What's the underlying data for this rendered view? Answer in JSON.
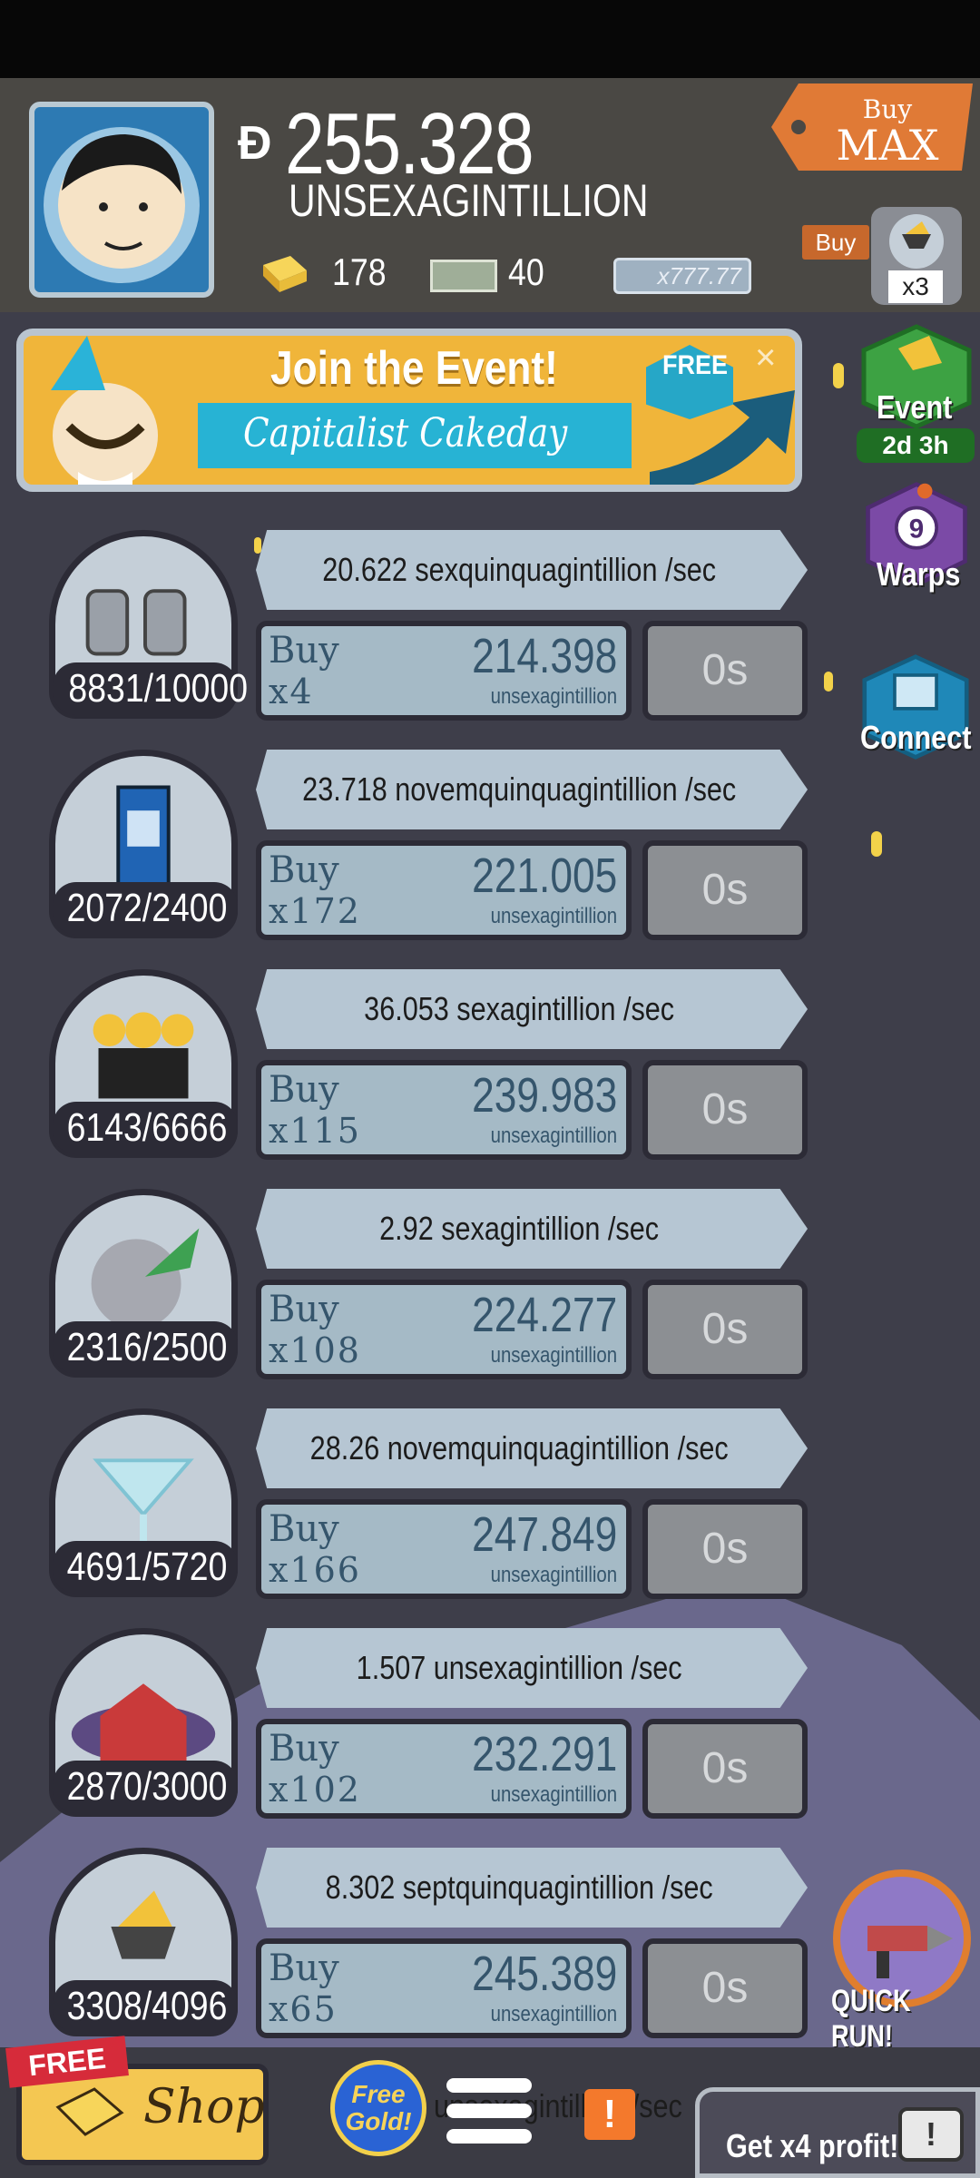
{
  "header": {
    "currency_symbol": "Ð",
    "money_amount": "255.328",
    "money_unit": "UNSEXAGINTILLION",
    "gold_count": "178",
    "megabucks_count": "40",
    "profit_multiplier": "x777.77",
    "buy_max_small": "Buy",
    "buy_max_big": "MAX",
    "buy_label": "Buy",
    "buy_qty_badge": "x3"
  },
  "event_banner": {
    "title": "Join the Event!",
    "subtitle": "Capitalist Cakeday",
    "free_label": "FREE",
    "close": "×"
  },
  "side_menu": {
    "event_label": "Event",
    "event_time": "2d 3h",
    "warps_count": "9",
    "warps_label": "Warps",
    "connect_label": "Connect",
    "quick_run_label": "QUICK RUN!"
  },
  "businesses": [
    {
      "icon": "moon-boots-icon",
      "owned": "8831/10000",
      "rate": "20.622 sexquinquagintillion /sec",
      "buy_word": "Buy",
      "buy_mult": "x4",
      "cost": "214.398",
      "cost_unit": "unsexagintillion",
      "timer": "0s"
    },
    {
      "icon": "phone-booth-icon",
      "owned": "2072/2400",
      "rate": "23.718 novemquinquagintillion /sec",
      "buy_word": "Buy",
      "buy_mult": "x172",
      "cost": "221.005",
      "cost_unit": "unsexagintillion",
      "timer": "0s"
    },
    {
      "icon": "clones-icon",
      "owned": "6143/6666",
      "rate": "36.053 sexagintillion /sec",
      "buy_word": "Buy",
      "buy_mult": "x115",
      "cost": "239.983",
      "cost_unit": "unsexagintillion",
      "timer": "0s"
    },
    {
      "icon": "moon-rocket-icon",
      "owned": "2316/2500",
      "rate": "2.92 sexagintillion /sec",
      "buy_word": "Buy",
      "buy_mult": "x108",
      "cost": "224.277",
      "cost_unit": "unsexagintillion",
      "timer": "0s"
    },
    {
      "icon": "cocktail-glass-icon",
      "owned": "4691/5720",
      "rate": "28.26 novemquinquagintillion /sec",
      "buy_word": "Buy",
      "buy_mult": "x166",
      "cost": "247.849",
      "cost_unit": "unsexagintillion",
      "timer": "0s"
    },
    {
      "icon": "red-barn-icon",
      "owned": "2870/3000",
      "rate": "1.507 unsexagintillion /sec",
      "buy_word": "Buy",
      "buy_mult": "x102",
      "cost": "232.291",
      "cost_unit": "unsexagintillion",
      "timer": "0s"
    },
    {
      "icon": "cheese-cart-icon",
      "owned": "3308/4096",
      "rate": "8.302 septquinquagintillion /sec",
      "buy_word": "Buy",
      "buy_mult": "x65",
      "cost": "245.389",
      "cost_unit": "unsexagintillion",
      "timer": "0s"
    }
  ],
  "bottom_bar": {
    "free_tag": "FREE",
    "shop_label": "Shop",
    "free_gold_label": "Free Gold!",
    "partial_rate": "unsexagintillion /sec",
    "alert": "!",
    "x4_label": "Get x4 profit!",
    "tv_badge": "!"
  },
  "colors": {
    "gold": "#f3d24a",
    "event_green": "#2f8c34",
    "warps_purple": "#7b4aa6",
    "connect_teal": "#1f88b8",
    "shop_yellow": "#f4c752"
  }
}
